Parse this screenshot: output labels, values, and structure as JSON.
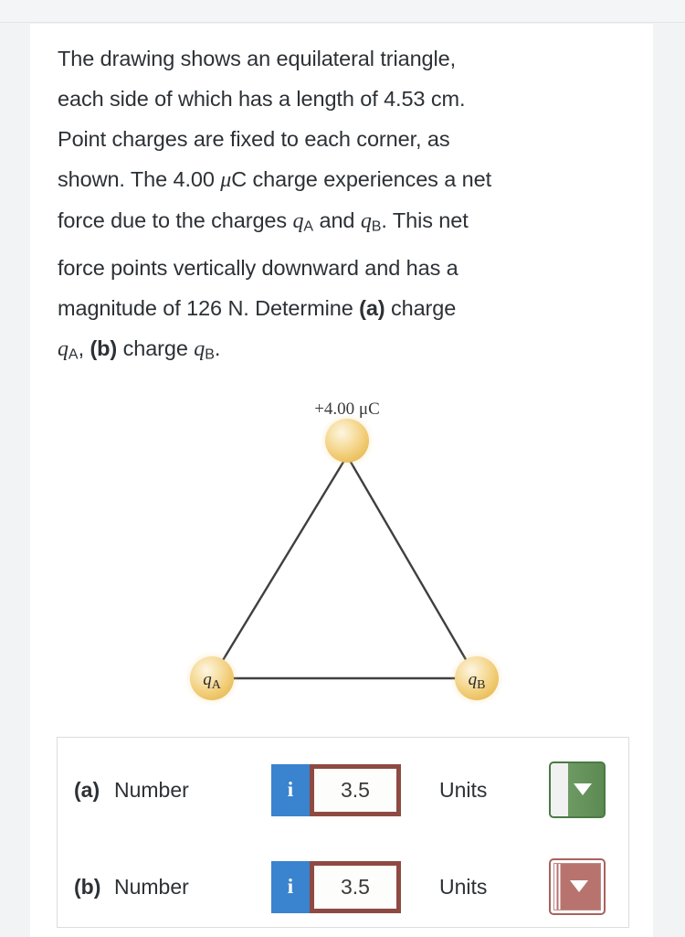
{
  "problem": {
    "line1": "The drawing shows an equilateral triangle,",
    "line2": "each side of which has a length of 4.53 cm.",
    "line3": "Point charges are fixed to each corner, as",
    "line4_pre": "shown. The 4.00 ",
    "line4_mu": "μ",
    "line4_post": "C charge experiences a net",
    "line5_pre": "force due to the charges ",
    "line5_qa": "q",
    "line5_qa_sub": "A",
    "line5_mid": " and ",
    "line5_qb": "q",
    "line5_qb_sub": "B",
    "line5_post": ". This net",
    "line6": "force points vertically downward and has a",
    "line7_pre": "magnitude of 126 N. Determine ",
    "line7_bold": "(a)",
    "line7_post": " charge",
    "line8_qa": "q",
    "line8_qa_sub": "A",
    "line8_comma": ", ",
    "line8_bold": "(b)",
    "line8_mid": " charge ",
    "line8_qb": "q",
    "line8_qb_sub": "B",
    "line8_period": "."
  },
  "figure": {
    "top_charge_label": "+4.00 μC",
    "left_charge_symbol": "q",
    "left_charge_subscript": "A",
    "right_charge_symbol": "q",
    "right_charge_subscript": "B",
    "sphere_color": "#f3cf80",
    "sphere_highlight": "#fdf4dc",
    "line_color": "#3f3f3f"
  },
  "answers": {
    "rows": [
      {
        "letter": "(a)",
        "number_label": "Number",
        "info_icon": "i",
        "value": "3.5",
        "placeholder": "",
        "units_label": "Units",
        "dropdown_variant": "green",
        "dropdown_icon": "chevron-down-icon"
      },
      {
        "letter": "(b)",
        "number_label": "Number",
        "info_icon": "i",
        "value": "3.5",
        "placeholder": "",
        "units_label": "Units",
        "dropdown_variant": "red",
        "dropdown_icon": "chevron-down-icon"
      }
    ]
  },
  "colors": {
    "input_border": "#8e4a42",
    "info_button": "#3a83ce",
    "dropdown_green": "#5c8a52",
    "dropdown_red": "#b8736e",
    "text": "#2c3136"
  }
}
